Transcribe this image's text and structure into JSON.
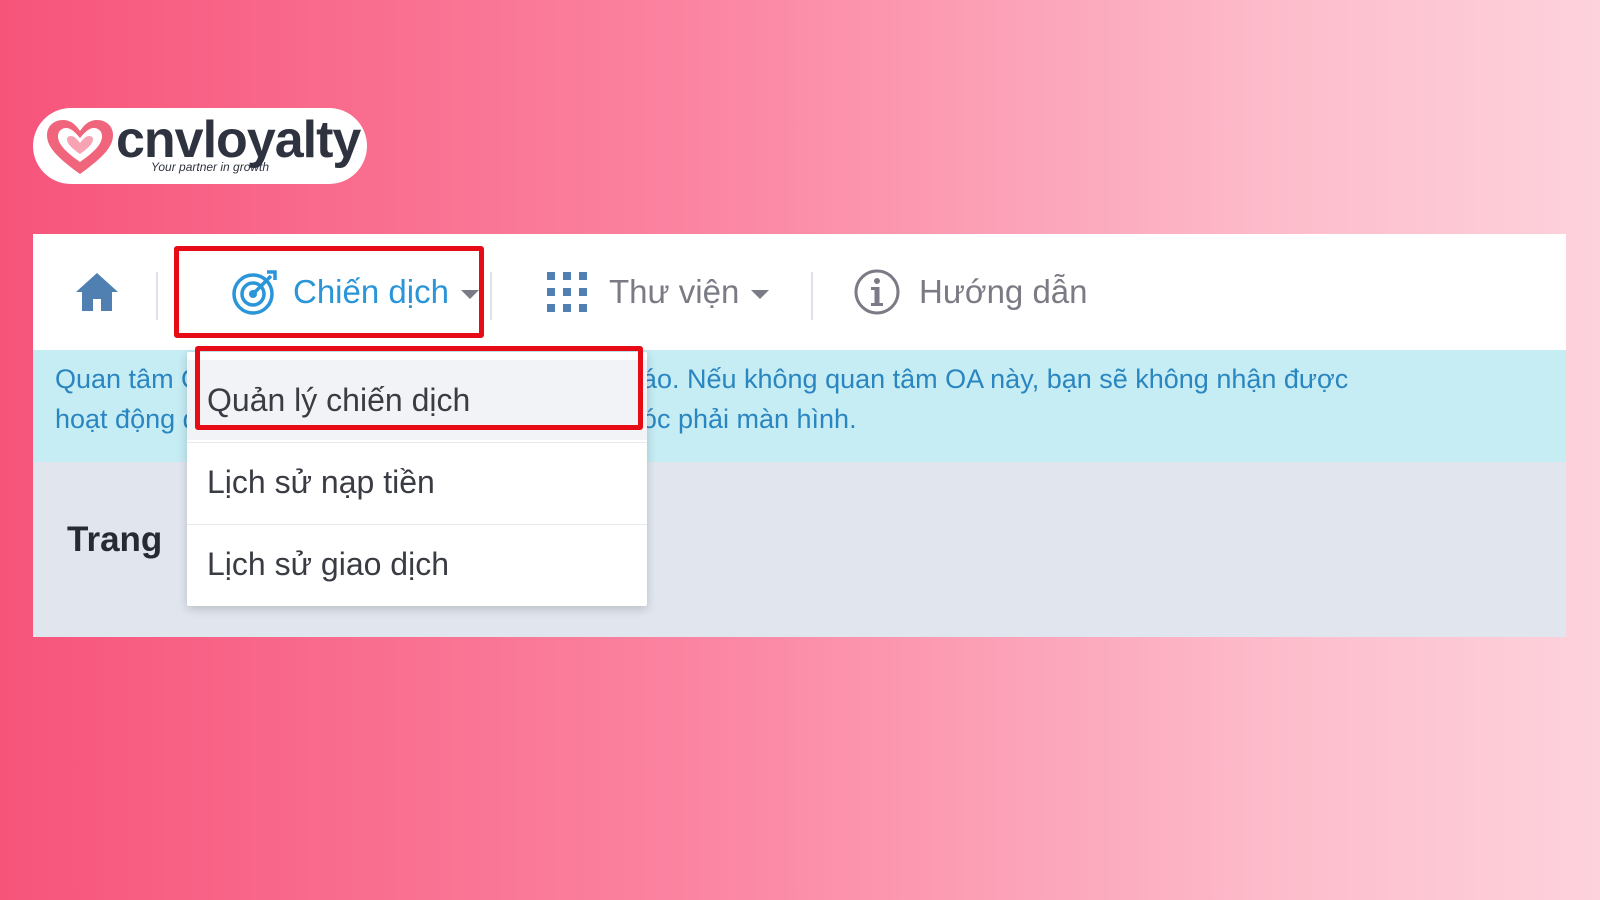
{
  "logo": {
    "brand": "cnvloyalty",
    "tagline": "Your partner in growth",
    "heart_color": "#f0647c"
  },
  "nav": {
    "home_icon": "home-icon",
    "campaign_label": "Chiến dịch",
    "campaign_icon": "target-icon",
    "library_label": "Thư viện",
    "library_icon": "grid-icon",
    "guide_label": "Hướng dẫn",
    "guide_icon": "info-icon",
    "accent_color": "#2a95d8"
  },
  "banner": {
    "line1": "Quan tâm OA này để nhận thông báo về quảng cáo. Nếu không quan tâm OA này, bạn sẽ không nhận được",
    "line2": "hoạt động quảng cáo, hãy quan tâm OA này tại góc phải màn hình."
  },
  "dropdown": {
    "items": [
      {
        "label": "Quản lý chiến dịch"
      },
      {
        "label": "Lịch sử nạp tiền"
      },
      {
        "label": "Lịch sử giao dịch"
      }
    ]
  },
  "page": {
    "title_fragment": "Trang"
  },
  "highlight_color": "#e60b14"
}
